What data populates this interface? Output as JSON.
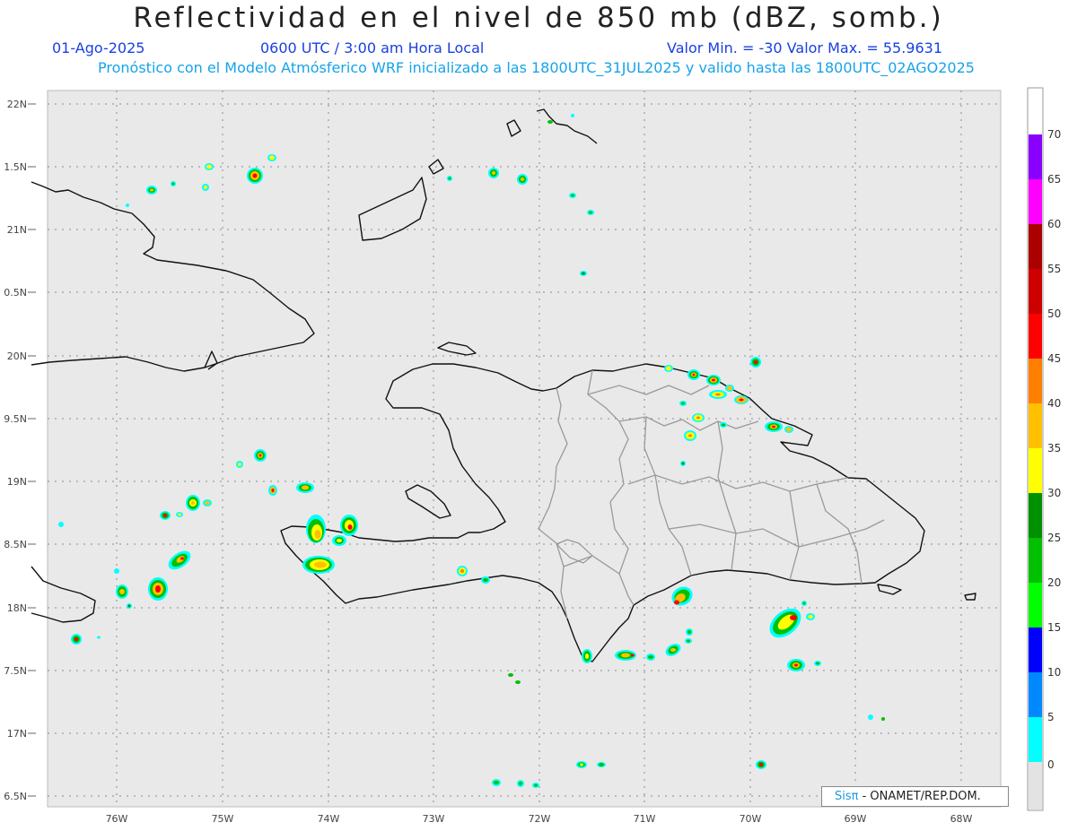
{
  "header": {
    "title": "Reflectividad en el nivel de 850 mb (dBZ, somb.)",
    "date": "01-Ago-2025",
    "time": "0600 UTC / 3:00 am Hora Local",
    "minmax": "Valor Min. = -30  Valor Max. = 55.9631",
    "model": "Pronóstico con el Modelo Atmósferico WRF inicializado a las 1800UTC_31JUL2025 y valido hasta las  1800UTC_02AGO2025"
  },
  "map": {
    "background": "#e9e9e9",
    "lat_labels": [
      "22N",
      "1.5N",
      "21N",
      "0.5N",
      "20N",
      "9.5N",
      "19N",
      "8.5N",
      "18N",
      "7.5N",
      "17N",
      "6.5N"
    ],
    "lon_labels": [
      "76W",
      "75W",
      "74W",
      "73W",
      "72W",
      "71W",
      "70W",
      "69W",
      "68W"
    ],
    "credit_sis": "Sisπ",
    "credit_rest": " - ONAMET/REP.DOM."
  },
  "colorbar": {
    "ticks": [
      "70",
      "65",
      "60",
      "55",
      "50",
      "45",
      "40",
      "35",
      "30",
      "25",
      "20",
      "15",
      "10",
      "5",
      "0"
    ],
    "colors": [
      "#8a00ff",
      "#ff00ff",
      "#aa0000",
      "#cc0000",
      "#ff0000",
      "#ff7f00",
      "#ffc000",
      "#ffff00",
      "#009000",
      "#00c000",
      "#00ff00",
      "#0000ff",
      "#0088ff",
      "#00ffff",
      "#e3e3e3"
    ]
  }
}
